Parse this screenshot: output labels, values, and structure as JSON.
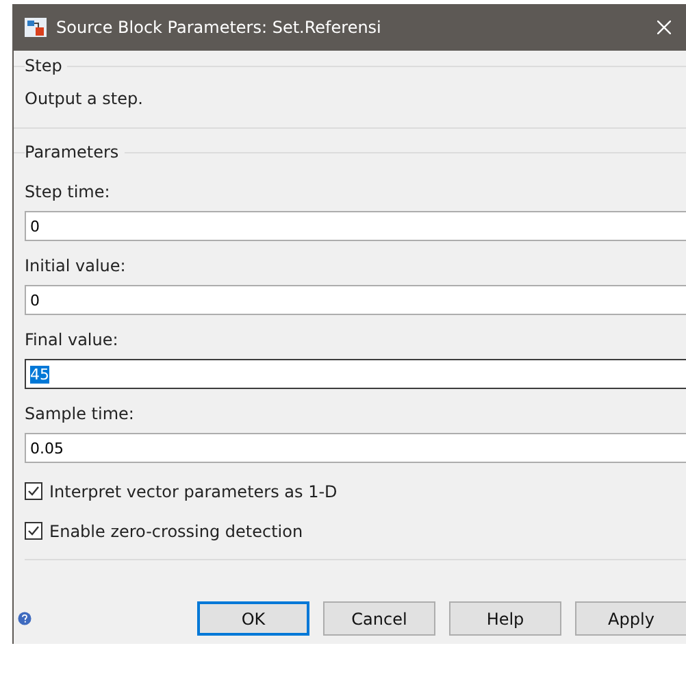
{
  "window": {
    "title": "Source Block Parameters: Set.Referensi"
  },
  "step_group": {
    "title": "Step",
    "description": "Output a step."
  },
  "parameters_group": {
    "title": "Parameters",
    "fields": [
      {
        "label": "Step time:",
        "value": "0",
        "focused": false
      },
      {
        "label": "Initial value:",
        "value": "0",
        "focused": false
      },
      {
        "label": "Final value:",
        "value": "45",
        "focused": true
      },
      {
        "label": "Sample time:",
        "value": "0.05",
        "focused": false
      }
    ],
    "checkboxes": [
      {
        "label": "Interpret vector parameters as 1-D",
        "checked": true
      },
      {
        "label": "Enable zero-crossing detection",
        "checked": true
      }
    ]
  },
  "buttons": [
    {
      "label": "OK",
      "default": true
    },
    {
      "label": "Cancel",
      "default": false
    },
    {
      "label": "Help",
      "default": false
    },
    {
      "label": "Apply",
      "default": false
    }
  ]
}
